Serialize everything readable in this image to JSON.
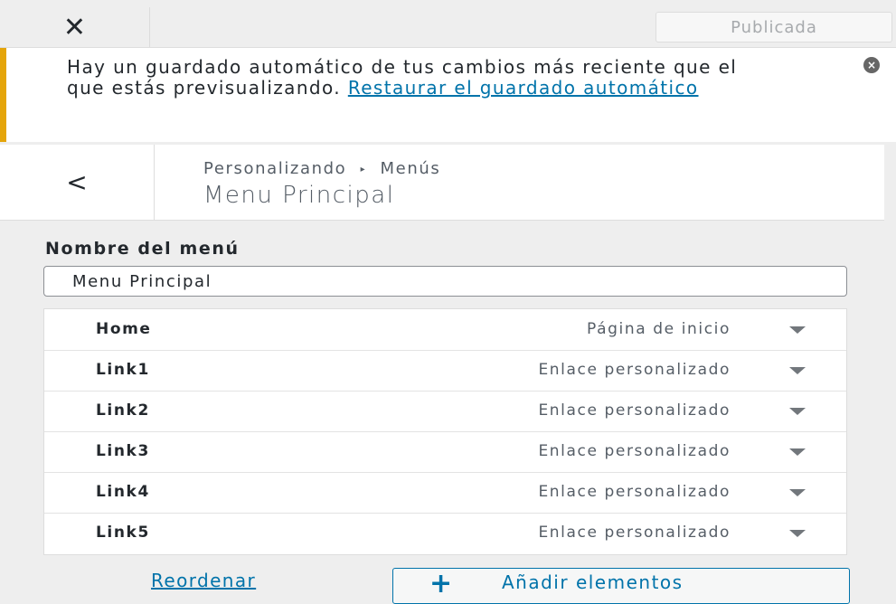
{
  "topbar": {
    "close_glyph": "✕",
    "publish_label": "Publicada"
  },
  "notice": {
    "text": "Hay un guardado automático de tus cambios más reciente que el que estás previsualizando.",
    "link_text": "Restaurar el guardado automático",
    "dismiss_icon": "dismiss-icon"
  },
  "section": {
    "breadcrumb_parent": "Personalizando",
    "breadcrumb_separator": "▸",
    "breadcrumb_current": "Menús",
    "title": "Menu Principal",
    "back_glyph": "<"
  },
  "menu_name": {
    "label": "Nombre del menú",
    "value": "Menu Principal"
  },
  "items": [
    {
      "title": "Home",
      "type": "Página de inicio"
    },
    {
      "title": "Link1",
      "type": "Enlace personalizado"
    },
    {
      "title": "Link2",
      "type": "Enlace personalizado"
    },
    {
      "title": "Link3",
      "type": "Enlace personalizado"
    },
    {
      "title": "Link4",
      "type": "Enlace personalizado"
    },
    {
      "title": "Link5",
      "type": "Enlace personalizado"
    }
  ],
  "actions": {
    "reorder_label": "Reordenar",
    "add_plus": "+",
    "add_label": "Añadir elementos"
  },
  "colors": {
    "accent": "#0073aa",
    "notice_border": "#e5a50a",
    "background": "#eeeeee"
  }
}
